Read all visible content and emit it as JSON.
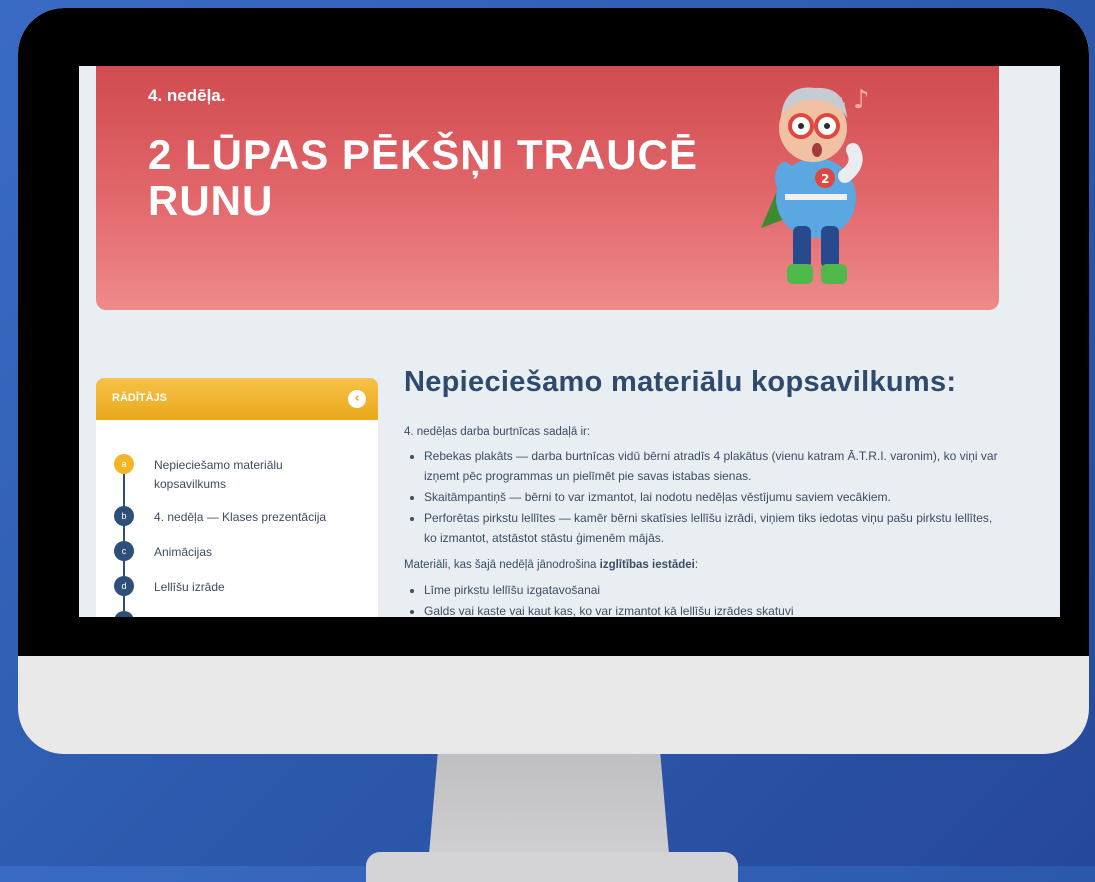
{
  "hero": {
    "week": "4. nedēļa.",
    "title": "2 LŪPAS PĒKŠŅI TRAUCĒ RUNU"
  },
  "sidebar": {
    "title": "RĀDĪTĀJS",
    "collapse_icon": "chevron-left-icon",
    "items": [
      {
        "marker": "a",
        "label": "Nepieciešamo materiālu kopsavilkums",
        "active": true
      },
      {
        "marker": "b",
        "label": "4. nedēļa — Klases prezentācija",
        "active": false
      },
      {
        "marker": "c",
        "label": "Animācijas",
        "active": false
      },
      {
        "marker": "d",
        "label": "Lellīšu izrāde",
        "active": false
      }
    ]
  },
  "main": {
    "heading": "Nepieciešamo materiālu kopsavilkums:",
    "intro": "4. nedēļas darba burtnīcas sadaļā ir:",
    "workbook_items": [
      "Rebekas plakāts — darba burtnīcas vidū bērni atradīs 4 plakātus (vienu katram Ā.T.R.I. varonim), ko viņi var izņemt pēc programmas un pielīmēt pie savas istabas sienas.",
      "Skaitāmpantiņš — bērni to var izmantot, lai nodotu nedēļas vēstījumu saviem vecākiem.",
      "Perforētas pirkstu lellītes — kamēr bērni skatīsies lellīšu izrādi, viņiem tiks iedotas viņu pašu pirkstu lellītes, ko izmantot, atstāstot stāstu ģimenēm mājās."
    ],
    "materials_prefix": "Materiāli, kas šajā nedēļā jānodrošina ",
    "materials_bold": "izglītības iestādei",
    "materials_suffix": ":",
    "institution_items": [
      "Līme pirkstu lellīšu izgatavošanai",
      "Galds vai kaste vai kaut kas, ko var izmantot kā lellīšu izrādes skatuvi"
    ]
  },
  "colors": {
    "background": "#2e5cb0",
    "hero_top": "#d04b4f",
    "hero_bottom": "#ef8a8a",
    "sidebar_header": "#f0b22e",
    "toc_marker": "#2d4f78",
    "toc_marker_active": "#f3b526",
    "heading": "#2f4a6d"
  }
}
